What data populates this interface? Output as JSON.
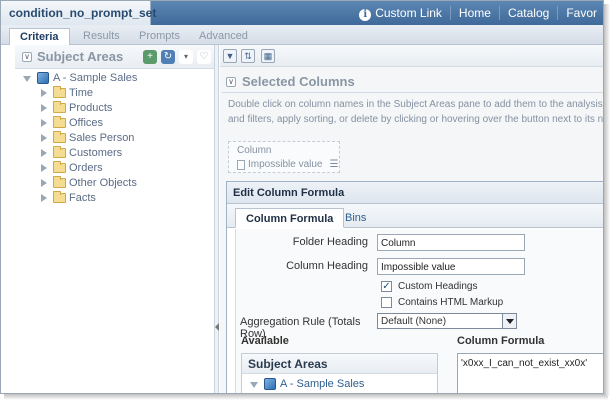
{
  "window": {
    "document_title": "condition_no_prompt_set"
  },
  "header_links": [
    {
      "label": "Custom Link",
      "icon": "info-icon"
    },
    {
      "label": "Home"
    },
    {
      "label": "Catalog"
    },
    {
      "label": "Favor"
    }
  ],
  "tabs": [
    {
      "label": "Criteria",
      "active": true
    },
    {
      "label": "Results"
    },
    {
      "label": "Prompts"
    },
    {
      "label": "Advanced"
    }
  ],
  "subject_areas_pane": {
    "title": "Subject Areas",
    "root": "A - Sample Sales",
    "folders": [
      "Time",
      "Products",
      "Offices",
      "Sales Person",
      "Customers",
      "Orders",
      "Other Objects",
      "Facts"
    ]
  },
  "selected_columns": {
    "title": "Selected Columns",
    "instructions": [
      "Double click on column names in the Subject Areas pane to add them to the analysis. Or",
      "and filters, apply sorting, or delete by clicking or hovering over the button next to its nam"
    ],
    "column": {
      "name": "Column",
      "value": "Impossible value"
    }
  },
  "edit_dialog": {
    "title": "Edit Column Formula",
    "tabs": [
      {
        "label": "Column Formula",
        "active": true
      },
      {
        "label": "Bins"
      }
    ],
    "folder_heading_label": "Folder Heading",
    "folder_heading_value": "Column",
    "column_heading_label": "Column Heading",
    "column_heading_value": "Impossible value",
    "custom_headings_label": "Custom Headings",
    "custom_headings_checked": true,
    "html_markup_label": "Contains HTML Markup",
    "html_markup_checked": false,
    "aggregation_label": "Aggregation Rule (Totals Row)",
    "aggregation_value": "Default (None)",
    "available_label": "Available",
    "available_head": "Subject Areas",
    "available_root": "A - Sample Sales",
    "formula_label": "Column Formula",
    "formula_value": "'x0xx_I_can_not_exist_xx0x'"
  }
}
